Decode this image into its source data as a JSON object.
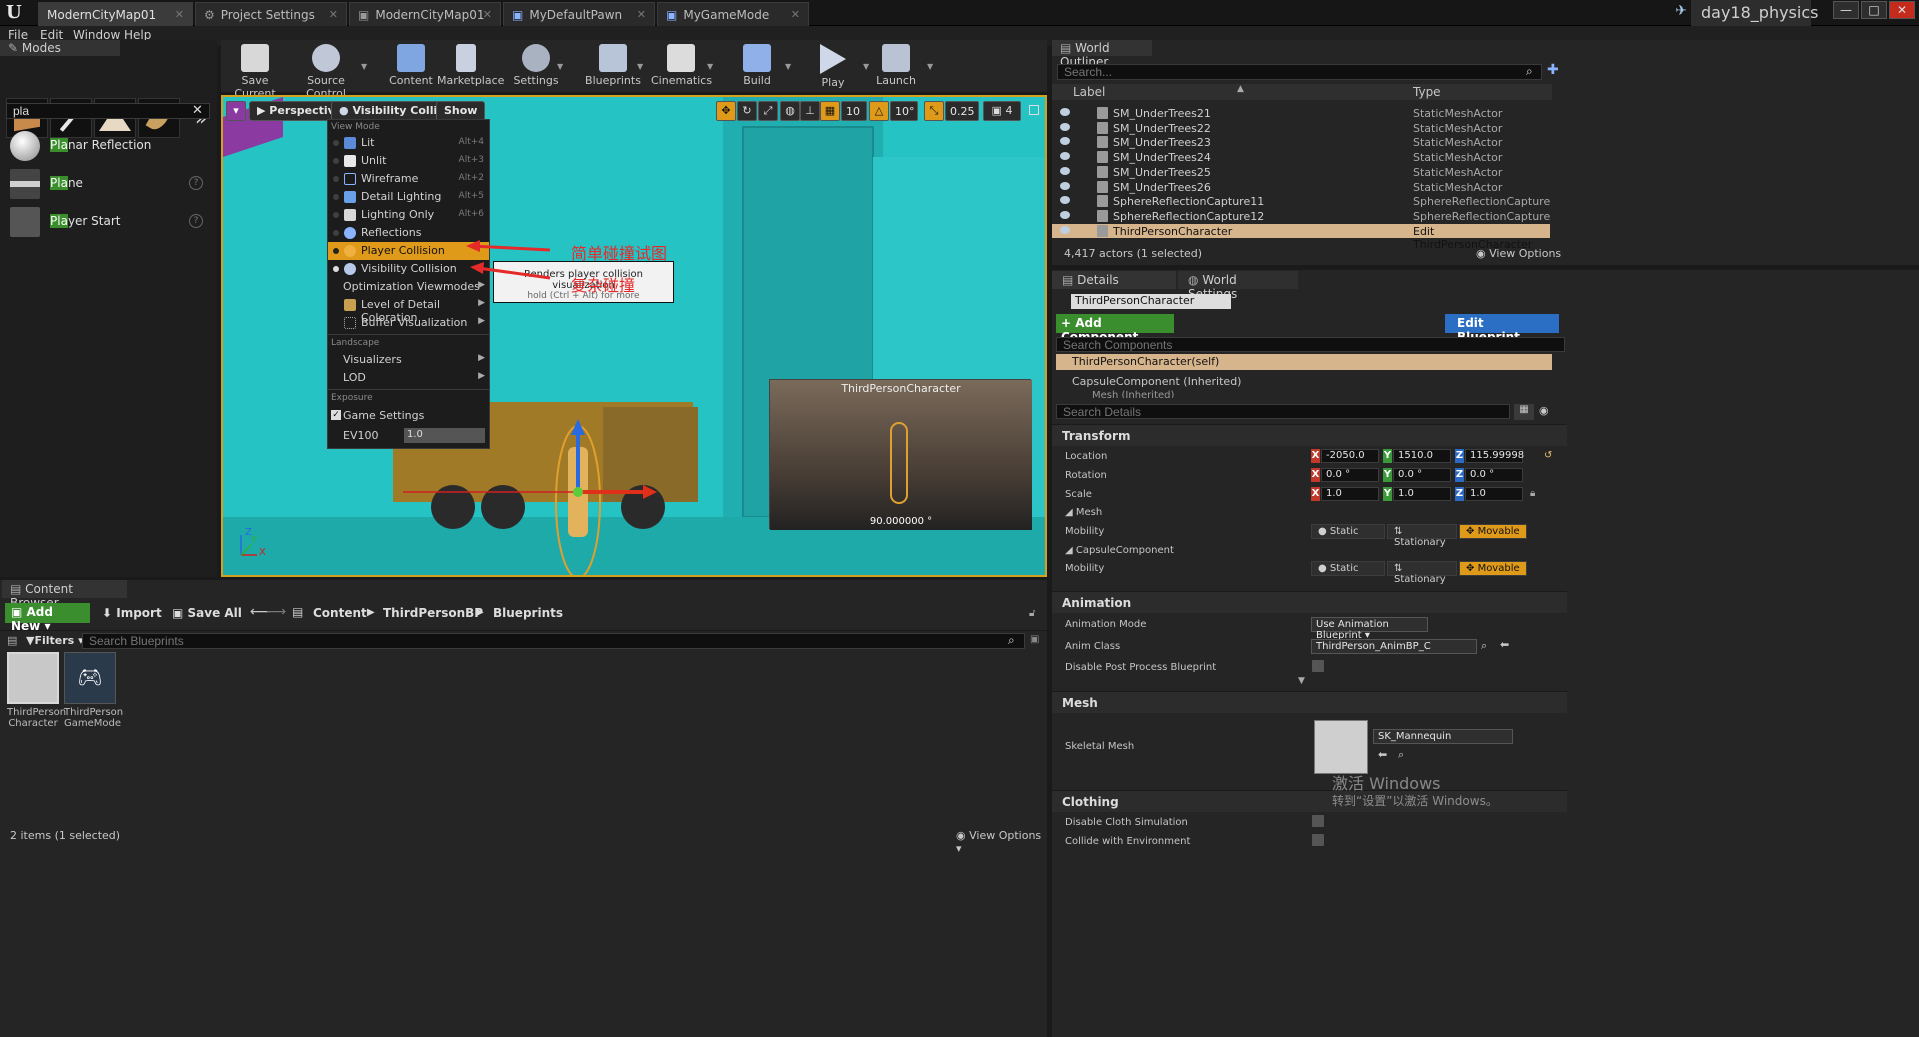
{
  "titlebar": {
    "tabs": [
      "ModernCityMap01",
      "Project Settings",
      "ModernCityMap01",
      "MyDefaultPawn",
      "MyGameMode"
    ],
    "project_name": "day18_physics",
    "minimize": "—",
    "maximize": "□",
    "close": "✕"
  },
  "menubar": {
    "items": [
      "File",
      "Edit",
      "Window",
      "Help"
    ]
  },
  "modes": {
    "title": "Modes",
    "search_value": "pla",
    "more": "»",
    "items": [
      {
        "match": "Pla",
        "rest": "nar Reflection"
      },
      {
        "match": "Pla",
        "rest": "ne"
      },
      {
        "match": "Pla",
        "rest": "yer Start"
      }
    ]
  },
  "toolbar": {
    "buttons": [
      "Save Current",
      "Source Control",
      "Content",
      "Marketplace",
      "Settings",
      "Blueprints",
      "Cinematics",
      "Build",
      "Play",
      "Launch"
    ]
  },
  "viewport": {
    "perspective": "Perspective",
    "view_mode": "Visibility Collision",
    "show": "Show",
    "grid_snap": "10",
    "rot_snap": "10°",
    "scale_snap": "0.25",
    "cam_speed": "4",
    "pip_title": "ThirdPersonCharacter",
    "pip_value": "90.000000 °",
    "axis_z": "Z",
    "axis_x": "X",
    "axis_y": "Y"
  },
  "view_menu": {
    "section_view_mode": "View Mode",
    "items": [
      {
        "label": "Lit",
        "shortcut": "Alt+4"
      },
      {
        "label": "Unlit",
        "shortcut": "Alt+3"
      },
      {
        "label": "Wireframe",
        "shortcut": "Alt+2"
      },
      {
        "label": "Detail Lighting",
        "shortcut": "Alt+5"
      },
      {
        "label": "Lighting Only",
        "shortcut": "Alt+6"
      },
      {
        "label": "Reflections",
        "shortcut": ""
      },
      {
        "label": "Player Collision",
        "shortcut": ""
      },
      {
        "label": "Visibility Collision",
        "shortcut": ""
      },
      {
        "label": "Optimization Viewmodes",
        "shortcut": ""
      },
      {
        "label": "Level of Detail Coloration",
        "shortcut": ""
      },
      {
        "label": "Buffer Visualization",
        "shortcut": ""
      }
    ],
    "section_landscape": "Landscape",
    "visualizers": "Visualizers",
    "lod": "LOD",
    "section_exposure": "Exposure",
    "game_settings": "Game Settings",
    "ev100_label": "EV100",
    "ev100_value": "1.0"
  },
  "tooltip": {
    "line1": "Renders player collision visualization",
    "line2": "hold (Ctrl + Alt) for more"
  },
  "annotations": {
    "simple_collision": "简单碰撞试图",
    "complex_collision": "复杂碰撞"
  },
  "outliner": {
    "title": "World Outliner",
    "search_placeholder": "Search...",
    "col_label": "Label",
    "col_type": "Type",
    "rows": [
      {
        "name": "SM_UnderTrees21",
        "type": "StaticMeshActor"
      },
      {
        "name": "SM_UnderTrees22",
        "type": "StaticMeshActor"
      },
      {
        "name": "SM_UnderTrees23",
        "type": "StaticMeshActor"
      },
      {
        "name": "SM_UnderTrees24",
        "type": "StaticMeshActor"
      },
      {
        "name": "SM_UnderTrees25",
        "type": "StaticMeshActor"
      },
      {
        "name": "SM_UnderTrees26",
        "type": "StaticMeshActor"
      },
      {
        "name": "SphereReflectionCapture11",
        "type": "SphereReflectionCapture"
      },
      {
        "name": "SphereReflectionCapture12",
        "type": "SphereReflectionCapture"
      },
      {
        "name": "ThirdPersonCharacter",
        "type": "Edit ThirdPersonCharacter"
      }
    ],
    "count": "4,417 actors (1 selected)",
    "view_options": "View Options"
  },
  "details": {
    "tab_details": "Details",
    "tab_world": "World Settings",
    "name_value": "ThirdPersonCharacter",
    "add_component": "+ Add Component",
    "edit_blueprint": "Edit Blueprint",
    "search_components": "Search Components",
    "comp_self": "ThirdPersonCharacter(self)",
    "comp_capsule": "CapsuleComponent (Inherited)",
    "comp_mesh": "Mesh (Inherited)",
    "search_details": "Search Details",
    "transform": "Transform",
    "location": "Location",
    "rotation": "Rotation",
    "scale": "Scale",
    "loc": [
      "-2050.0",
      "1510.0",
      "115.99998"
    ],
    "rot": [
      "0.0 °",
      "0.0 °",
      "0.0 °"
    ],
    "scl": [
      "1.0",
      "1.0",
      "1.0"
    ],
    "mesh_sub": "Mesh",
    "capsule_sub": "CapsuleComponent",
    "mobility": "Mobility",
    "static": "Static",
    "stationary": "Stationary",
    "movable": "Movable",
    "animation": "Animation",
    "anim_mode_lbl": "Animation Mode",
    "anim_mode_val": "Use Animation Blueprint",
    "anim_class_lbl": "Anim Class",
    "anim_class_val": "ThirdPerson_AnimBP_C",
    "disable_pp": "Disable Post Process Blueprint",
    "mesh_section": "Mesh",
    "skeletal_mesh": "Skeletal Mesh",
    "sk_value": "SK_Mannequin",
    "clothing": "Clothing",
    "disable_cloth": "Disable Cloth Simulation",
    "collide_env": "Collide with Environment",
    "watermark1": "激活 Windows",
    "watermark2": "转到“设置”以激活 Windows。"
  },
  "content_browser": {
    "title": "Content Browser",
    "add_new": "Add New",
    "import": "Import",
    "save_all": "Save All",
    "path": [
      "Content",
      "ThirdPersonBP",
      "Blueprints"
    ],
    "filters": "Filters",
    "search_placeholder": "Search Blueprints",
    "assets": [
      {
        "line1": "ThirdPerson",
        "line2": "Character"
      },
      {
        "line1": "ThirdPerson",
        "line2": "GameMode"
      }
    ],
    "status": "2 items (1 selected)",
    "view_options": "View Options"
  },
  "colors": {
    "accent_orange": "#e09a19",
    "viewport_cyan": "#26c3c5",
    "add_green": "#3b8e2e",
    "edit_blue": "#2a6fc4",
    "annotation_red": "#e52a2a"
  }
}
